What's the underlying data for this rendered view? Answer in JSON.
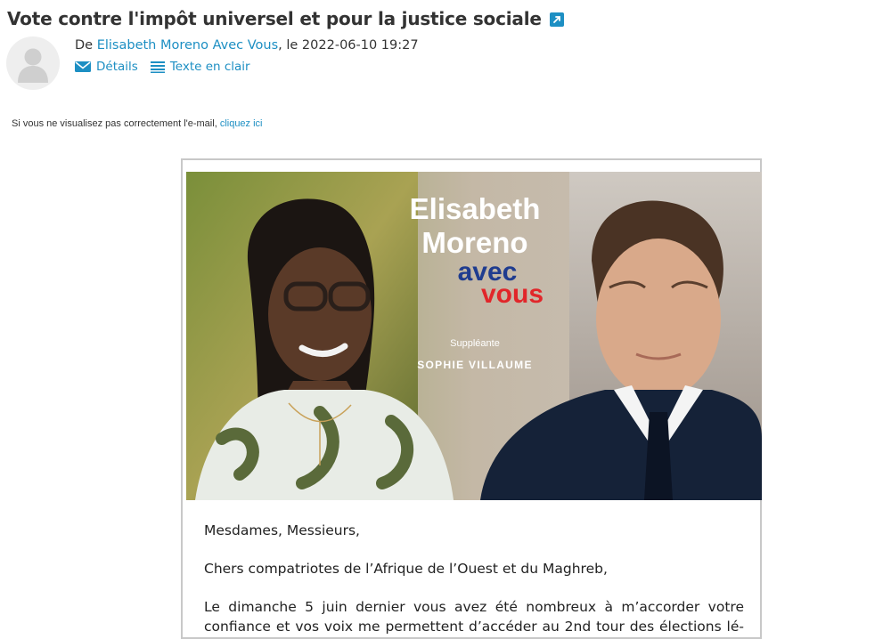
{
  "email": {
    "subject": "Vote contre l'impôt universel et pour la justice sociale",
    "from_prefix": "De",
    "sender": "Elisabeth Moreno Avec Vous",
    "date_text": ", le 2022-06-10 19:27",
    "actions": {
      "details": "Détails",
      "plain_text": "Texte en clair"
    }
  },
  "notice": {
    "text": "Si vous ne visualisez pas correctement l'e-mail, ",
    "link": "cliquez ici"
  },
  "banner": {
    "name_line1": "Elisabeth",
    "name_line2": "Moreno",
    "avec": "avec",
    "vous": "vous",
    "suppleante_label": "Suppléante",
    "suppleante_name": "SOPHIE VILLAUME"
  },
  "body": {
    "greeting": "Mesdames, Messieurs,",
    "salutation": "Chers compatriotes de l’Afrique de l’Ouest et du Maghreb,",
    "para_line1": "Le dimanche 5 juin dernier vous avez été nombreux à m’accorder votre",
    "para_line2": "confiance et vos voix me permettent d’accéder au 2nd tour des élections lé-"
  },
  "colors": {
    "link": "#1d8fc3",
    "avec_blue": "#1f3c8f",
    "vous_red": "#e1262a"
  }
}
